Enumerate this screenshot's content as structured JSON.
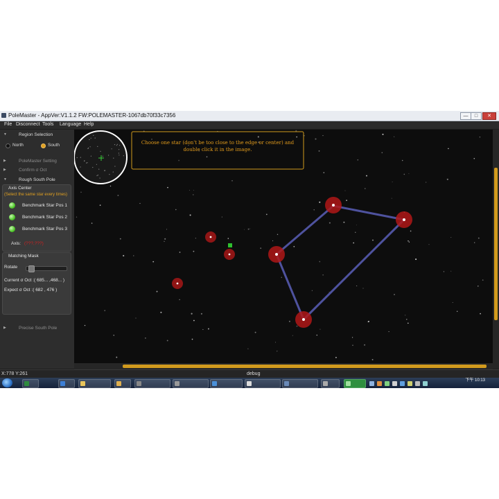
{
  "window": {
    "title": "PoleMaster - AppVer:V1.1.2 FW:POLEMASTER-1067db70f33c7356",
    "minimize_label": "—",
    "maximize_label": "□",
    "close_label": "✕"
  },
  "menu": [
    "File",
    "Disconnect",
    "Tools",
    "Language",
    "Help"
  ],
  "sidebar": {
    "region_title": "Region Selection",
    "north_label": "North",
    "south_label": "South",
    "selected_region": "South",
    "polemaster_setting": "PoleMaster Setting",
    "confirm_oct": "Confirm σ Oct",
    "rough_south_pole": "Rough South Pole",
    "axis_center": "Axis Center",
    "axis_hint": "(Select the same star every times)",
    "benchmarks": [
      "Benchmark Star Pos 1",
      "Benchmark Star Pos 2",
      "Benchmark Star Pos 3"
    ],
    "axis_label": "Axis:",
    "axis_value": "(???,???)",
    "matching_mask": "Matching Mask",
    "rotate_label": "Rotate",
    "rotate_value": 0.05,
    "current_oct": "Current σ Oct :( 685... ,468... )",
    "expect_oct": "Expect σ Oct :( 682   , 476   )",
    "precise_south_pole": "Precise South Pole"
  },
  "instruction": "Choose one star (don't be too close to the edge or center) and double click it in the image.",
  "statusbar": {
    "coords": "X:778 Y:261",
    "debug": "debug"
  },
  "taskbar": {
    "clock_line1": "下午 10:13",
    "items": [
      "",
      "",
      "",
      "",
      "",
      "",
      "",
      "",
      "",
      "",
      "",
      ""
    ]
  },
  "colors": {
    "accent": "#d19a1d",
    "marker_red": "#b01818",
    "line_blue": "#5a5fb8",
    "hint_red": "#d02020"
  }
}
